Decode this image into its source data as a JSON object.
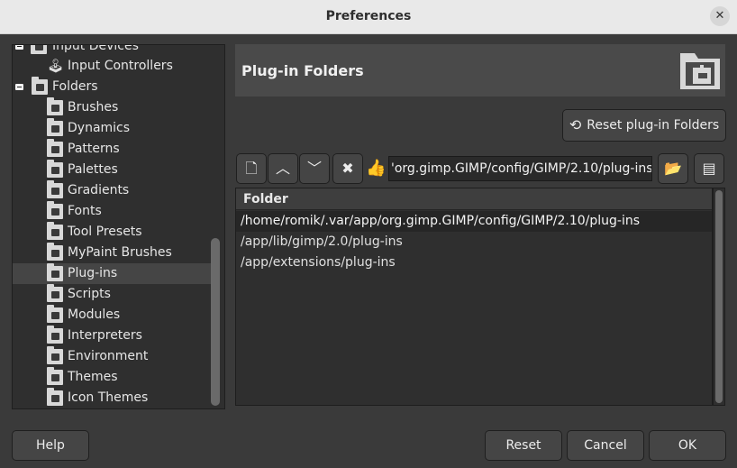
{
  "window": {
    "title": "Preferences",
    "close_glyph": "✕"
  },
  "tree": {
    "items": [
      {
        "label": "Input Devices",
        "icon": "input-devices-icon",
        "expander": true
      },
      {
        "label": "Input Controllers",
        "icon": "input-controllers-icon"
      },
      {
        "label": "Folders",
        "icon": "folder-icon",
        "expander": true
      },
      {
        "label": "Brushes",
        "icon": "brushes-folder-icon"
      },
      {
        "label": "Dynamics",
        "icon": "dynamics-folder-icon"
      },
      {
        "label": "Patterns",
        "icon": "patterns-folder-icon"
      },
      {
        "label": "Palettes",
        "icon": "palettes-folder-icon"
      },
      {
        "label": "Gradients",
        "icon": "gradients-folder-icon"
      },
      {
        "label": "Fonts",
        "icon": "fonts-folder-icon"
      },
      {
        "label": "Tool Presets",
        "icon": "tool-presets-folder-icon"
      },
      {
        "label": "MyPaint Brushes",
        "icon": "mypaint-brushes-folder-icon"
      },
      {
        "label": "Plug-ins",
        "icon": "plugins-folder-icon",
        "selected": true
      },
      {
        "label": "Scripts",
        "icon": "scripts-folder-icon"
      },
      {
        "label": "Modules",
        "icon": "modules-folder-icon"
      },
      {
        "label": "Interpreters",
        "icon": "interpreters-folder-icon"
      },
      {
        "label": "Environment",
        "icon": "environment-folder-icon"
      },
      {
        "label": "Themes",
        "icon": "themes-folder-icon"
      },
      {
        "label": "Icon Themes",
        "icon": "icon-themes-folder-icon"
      }
    ]
  },
  "panel": {
    "title": "Plug-in Folders",
    "reset_label": "Reset plug-in Folders",
    "path_value": "'org.gimp.GIMP/config/GIMP/2.10/plug-ins",
    "toolbar": {
      "new_glyph": "🗋",
      "up_glyph": "︿",
      "down_glyph": "﹀",
      "delete_glyph": "✖",
      "ok_glyph": "👍",
      "browse_glyph": "📂",
      "edit_glyph": "▤"
    },
    "list": {
      "header": "Folder",
      "rows": [
        "/home/romik/.var/app/org.gimp.GIMP/config/GIMP/2.10/plug-ins",
        "/app/lib/gimp/2.0/plug-ins",
        "/app/extensions/plug-ins"
      ]
    }
  },
  "buttons": {
    "help": "Help",
    "reset": "Reset",
    "cancel": "Cancel",
    "ok": "OK"
  }
}
